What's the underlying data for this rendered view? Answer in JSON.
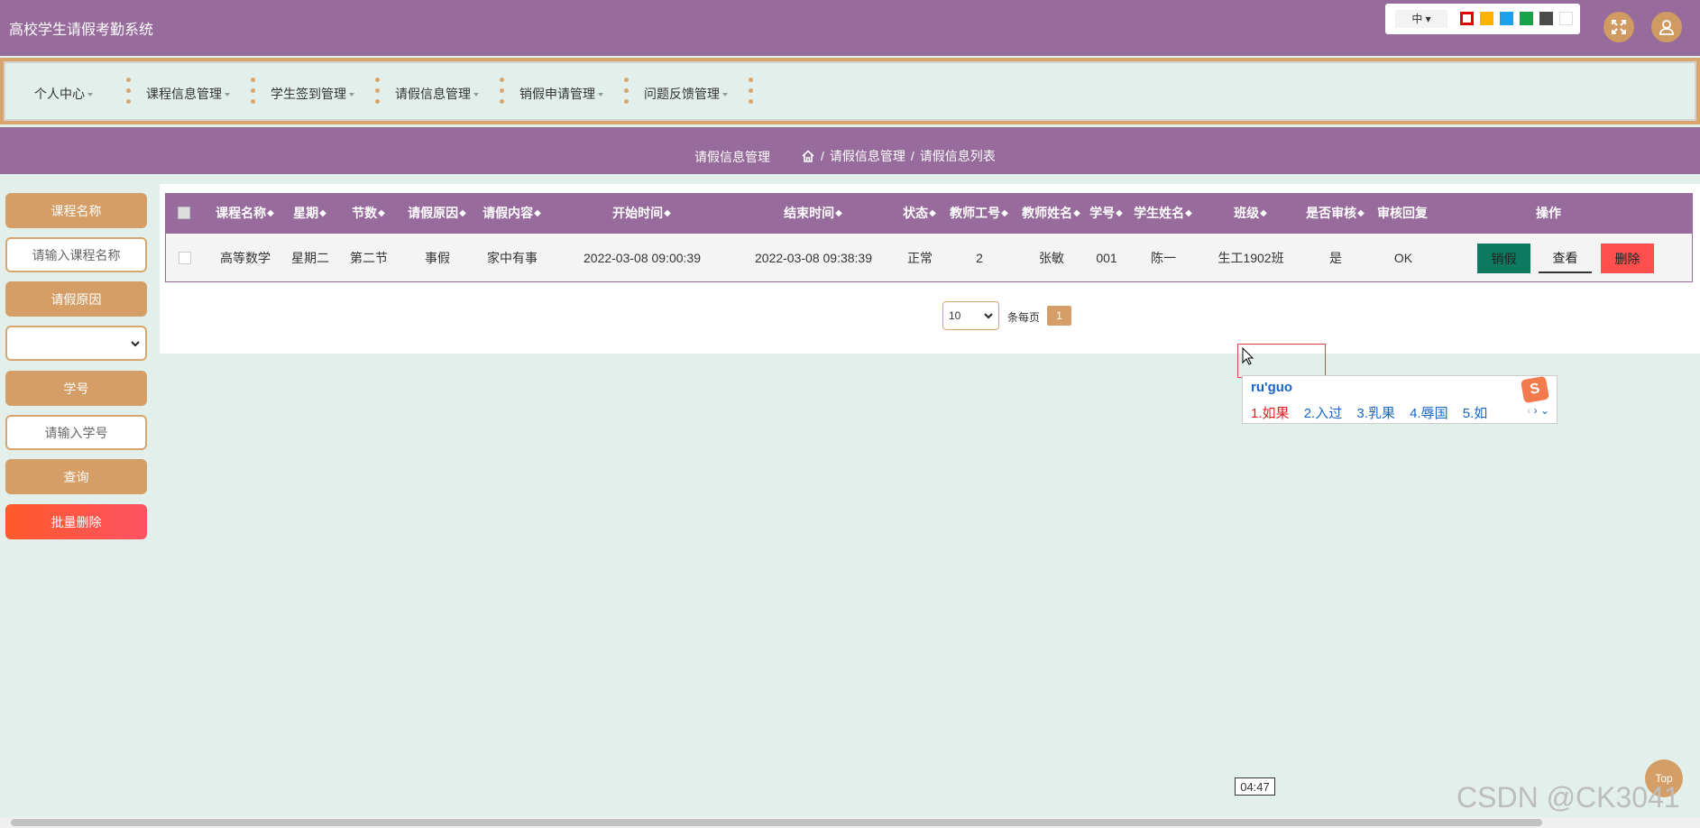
{
  "app": {
    "title": "高校学生请假考勤系统"
  },
  "theme_panel": {
    "lang": "中",
    "swatches": [
      "#ffffff",
      "#ffb200",
      "#1e9fe8",
      "#18a34a",
      "#4b4b4b",
      "#ffffff"
    ]
  },
  "nav": {
    "items": [
      {
        "label": "个人中心"
      },
      {
        "label": "课程信息管理"
      },
      {
        "label": "学生签到管理"
      },
      {
        "label": "请假信息管理"
      },
      {
        "label": "销假申请管理"
      },
      {
        "label": "问题反馈管理"
      }
    ]
  },
  "header": {
    "title": "请假信息管理",
    "breadcrumb": [
      "请假信息管理",
      "请假信息列表"
    ],
    "sep": "/"
  },
  "sidebar": {
    "course_label": "课程名称",
    "course_placeholder": "请输入课程名称",
    "reason_label": "请假原因",
    "student_no_label": "学号",
    "student_no_placeholder": "请输入学号",
    "query_button": "查询",
    "batch_delete_button": "批量删除"
  },
  "table": {
    "sort_glyph": "◆",
    "columns": [
      "课程名称",
      "星期",
      "节数",
      "请假原因",
      "请假内容",
      "开始时间",
      "结束时间",
      "状态",
      "教师工号",
      "教师姓名",
      "学号",
      "学生姓名",
      "班级",
      "是否审核",
      "审核回复",
      "操作"
    ],
    "rows": [
      {
        "cells": [
          "高等数学",
          "星期二",
          "第二节",
          "事假",
          "家中有事",
          "2022-03-08 09:00:39",
          "2022-03-08 09:38:39",
          "正常",
          "2",
          "张敏",
          "001",
          "陈一",
          "生工1902班",
          "是",
          "OK"
        ],
        "actions": [
          "销假",
          "查看",
          "删除"
        ]
      }
    ]
  },
  "pager": {
    "page_size": "10",
    "per_page_label": "条每页",
    "current_page": "1"
  },
  "ime": {
    "pinyin": "ru'guo",
    "candidates": [
      "1.如果",
      "2.入过",
      "3.乳果",
      "4.辱国",
      "5.如"
    ],
    "logo": "S"
  },
  "overlay": {
    "time": "04:47",
    "top_button": "Top",
    "watermark": "CSDN @CK3041"
  },
  "colors": {
    "primary": "#976b9b",
    "accent": "#d49e66",
    "background": "#e3efea",
    "danger": "#ff5263",
    "success": "#0d7a5f"
  }
}
